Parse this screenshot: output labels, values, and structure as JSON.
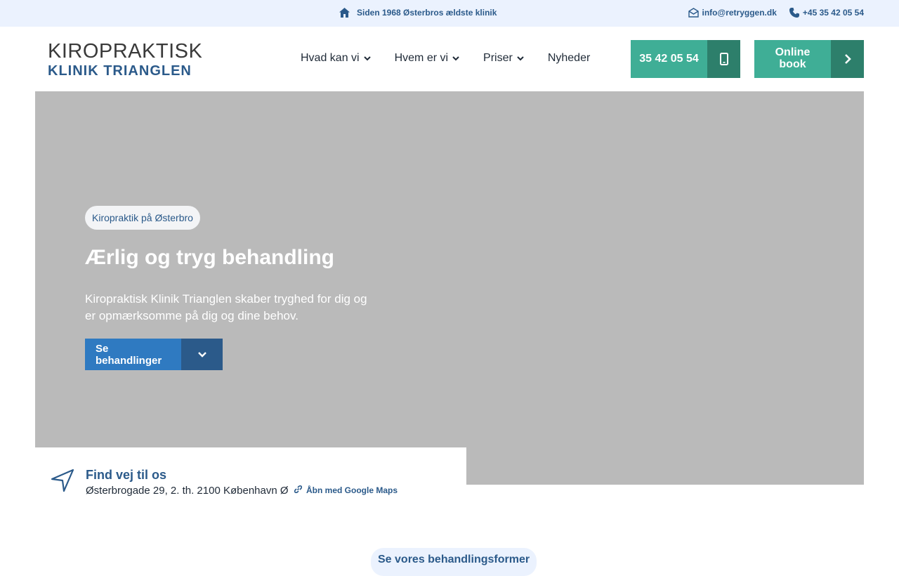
{
  "topbar": {
    "tagline": "Siden 1968 Østerbros ældste klinik",
    "email": "info@retryggen.dk",
    "phone": "+45 35 42 05 54"
  },
  "logo": {
    "line1": "KIROPRAKTISK",
    "line2": "KLINIK TRIANGLEN",
    "colors": [
      "#e33b8c",
      "#2fb5c9",
      "#2b5a8a"
    ]
  },
  "nav": {
    "items": [
      {
        "label": "Hvad kan vi",
        "has_dropdown": true
      },
      {
        "label": "Hvem er vi",
        "has_dropdown": true
      },
      {
        "label": "Priser",
        "has_dropdown": true
      },
      {
        "label": "Nyheder",
        "has_dropdown": false
      }
    ]
  },
  "cta": {
    "phone_label": "35 42 05 54",
    "book_label": "Online book"
  },
  "hero": {
    "pill": "Kiropraktik på Østerbro",
    "title": "Ærlig og tryg behandling",
    "text": "Kiropraktisk Klinik Trianglen skaber tryghed for dig og er opmærksomme på dig og dine behov.",
    "button_label": "Se behandlinger"
  },
  "location": {
    "title": "Find vej til os",
    "address": "Østerbrogade 29, 2. th. 2100 København Ø",
    "maps_link": "Åbn med Google Maps"
  },
  "bottom": {
    "pill": "Se vores behandlingsformer"
  },
  "colors": {
    "brand_blue": "#2b5a8a",
    "button_blue": "#2f7ac1",
    "green": "#3fae96",
    "green_dark": "#2d7f6b",
    "topbar_bg": "#ebf2fe",
    "hero_bg": "#bababa"
  }
}
